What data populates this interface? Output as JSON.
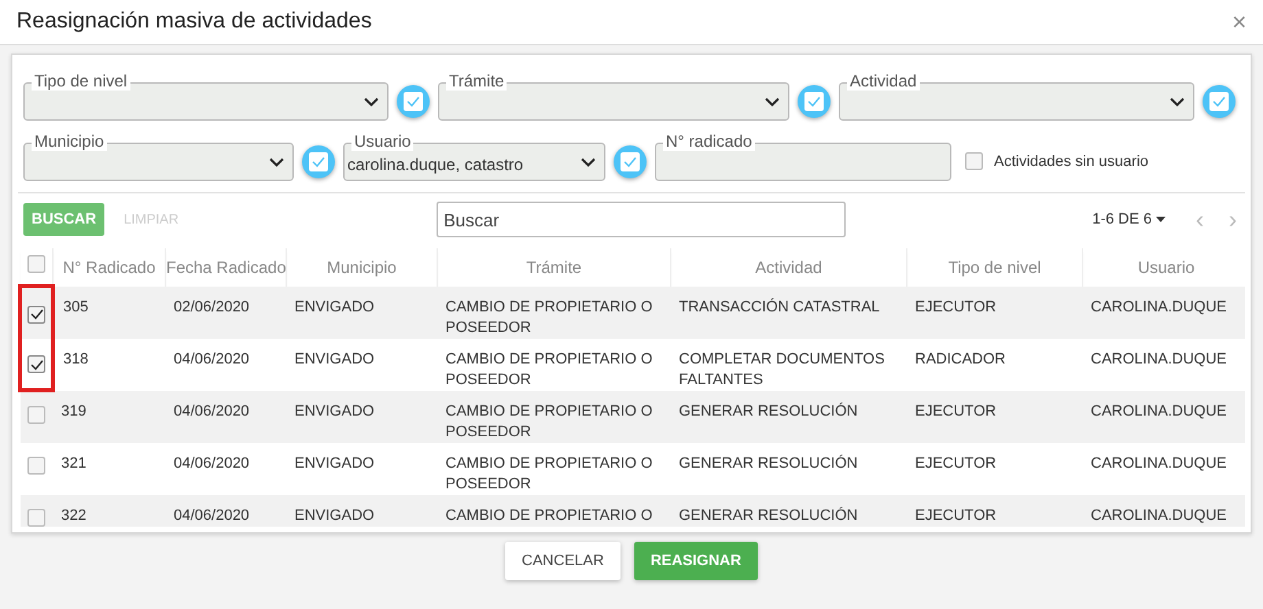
{
  "window": {
    "title": "Reasignación masiva de actividades",
    "close": "×"
  },
  "filters": [
    {
      "kind": "select",
      "label": "Tipo de nivel",
      "toggle_checked": true
    },
    {
      "kind": "select",
      "label": "Trámite",
      "toggle_checked": true
    },
    {
      "kind": "select",
      "label": "Actividad",
      "toggle_checked": true
    },
    {
      "kind": "select",
      "label": "Municipio",
      "toggle_checked": true
    },
    {
      "kind": "select",
      "label": "Usuario",
      "value": "carolina.duque, catastro",
      "toggle_checked": true
    },
    {
      "kind": "text",
      "label": "N° radicado"
    }
  ],
  "no_user_option": {
    "label": "Actividades sin usuario",
    "checked": false
  },
  "toolbar": {
    "search_button": "BUSCAR",
    "clear_button": "LIMPIAR",
    "clear_disabled": true,
    "search": {
      "placeholder": "Buscar"
    },
    "pagination": "1-6 DE 6",
    "prev": "‹",
    "next": "›"
  },
  "table": {
    "all_checked": false,
    "columns": [
      "N° Radicado",
      "Fecha Radicado",
      "Municipio",
      "Trámite",
      "Actividad",
      "Tipo de nivel",
      "Usuario"
    ],
    "rows": [
      {
        "checked": true,
        "highlighted": true,
        "cells": [
          "305",
          "02/06/2020",
          "ENVIGADO",
          "CAMBIO DE PROPIETARIO O POSEEDOR",
          "TRANSACCIÓN CATASTRAL",
          "EJECUTOR",
          "CAROLINA.DUQUE"
        ]
      },
      {
        "checked": true,
        "highlighted": true,
        "cells": [
          "318",
          "04/06/2020",
          "ENVIGADO",
          "CAMBIO DE PROPIETARIO O POSEEDOR",
          "COMPLETAR DOCUMENTOS FALTANTES",
          "RADICADOR",
          "CAROLINA.DUQUE"
        ]
      },
      {
        "checked": false,
        "highlighted": false,
        "cells": [
          "319",
          "04/06/2020",
          "ENVIGADO",
          "CAMBIO DE PROPIETARIO O POSEEDOR",
          "GENERAR RESOLUCIÓN",
          "EJECUTOR",
          "CAROLINA.DUQUE"
        ]
      },
      {
        "checked": false,
        "highlighted": false,
        "cells": [
          "321",
          "04/06/2020",
          "ENVIGADO",
          "CAMBIO DE PROPIETARIO O POSEEDOR",
          "GENERAR RESOLUCIÓN",
          "EJECUTOR",
          "CAROLINA.DUQUE"
        ]
      },
      {
        "checked": false,
        "highlighted": false,
        "cells": [
          "322",
          "04/06/2020",
          "ENVIGADO",
          "CAMBIO DE PROPIETARIO O",
          "GENERAR RESOLUCIÓN",
          "EJECUTOR",
          "CAROLINA.DUQUE"
        ]
      }
    ]
  },
  "buttons": [
    {
      "kind": "secondary",
      "label": "CANCELAR"
    },
    {
      "kind": "primary",
      "label": "REASIGNAR"
    }
  ]
}
